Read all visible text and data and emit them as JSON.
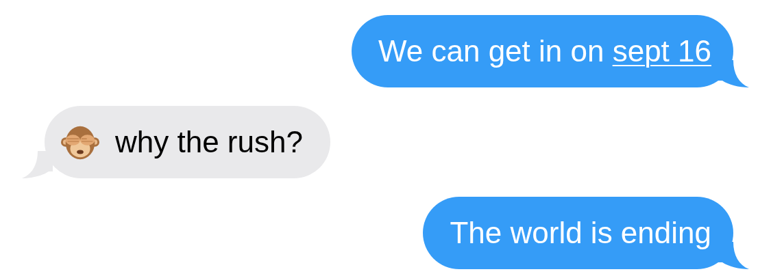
{
  "messages": [
    {
      "kind": "outgoing",
      "parts": [
        {
          "kind": "text",
          "text": "We can get in on "
        },
        {
          "kind": "link",
          "text": "sept 16"
        }
      ]
    },
    {
      "kind": "incoming",
      "parts": [
        {
          "kind": "emoji"
        },
        {
          "kind": "text",
          "text": "why the rush?"
        }
      ]
    },
    {
      "kind": "outgoing",
      "parts": [
        {
          "kind": "text",
          "text": "The world is ending"
        }
      ]
    }
  ]
}
